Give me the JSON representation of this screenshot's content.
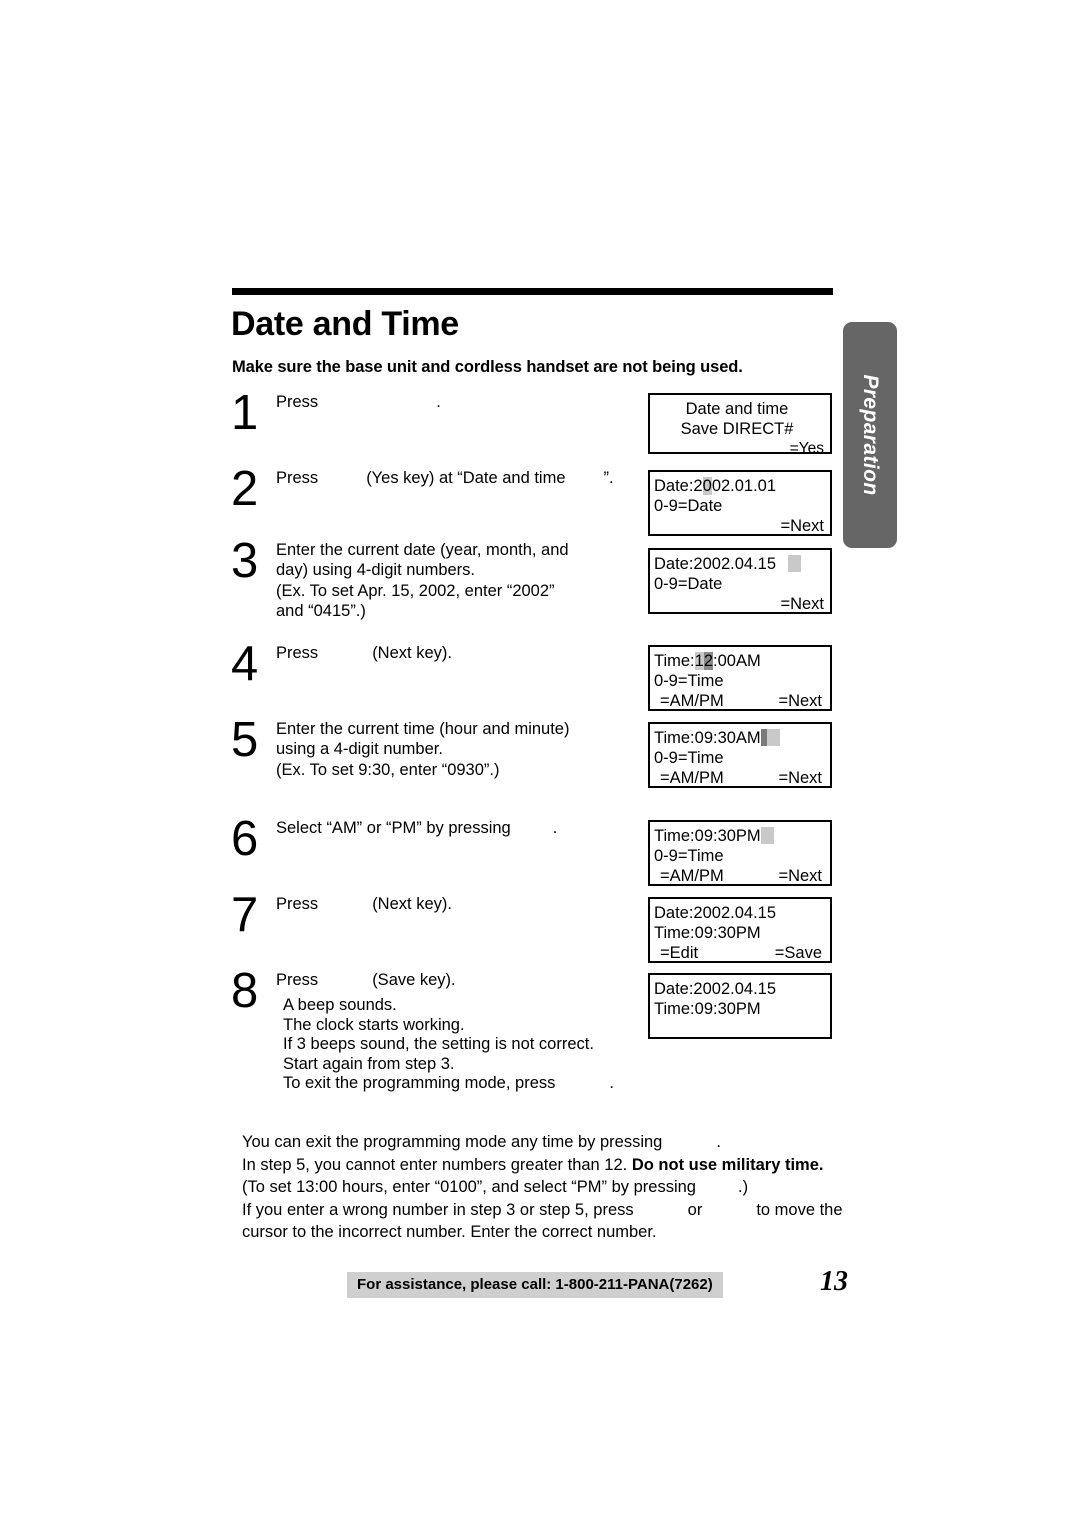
{
  "side_tab": {
    "label": "Preparation",
    "color": "#666666"
  },
  "header": {
    "title": "Date and Time",
    "subtitle": "Make sure the base unit and cordless handset are not being used."
  },
  "steps": [
    {
      "number": "1",
      "text_before": "Press",
      "text_after": "."
    },
    {
      "number": "2",
      "text_before": "Press",
      "text_mid": "(Yes key) at “Date and time",
      "text_after": "”."
    },
    {
      "number": "3",
      "line1": "Enter the current date (year, month, and",
      "line2": "day) using 4-digit numbers.",
      "line3": "(Ex. To set Apr. 15, 2002, enter “2002”",
      "line4": "and “0415”.)"
    },
    {
      "number": "4",
      "text_before": "Press",
      "text_after": "(Next  key)."
    },
    {
      "number": "5",
      "line1": "Enter the current time (hour and minute)",
      "line2": "using a 4-digit number.",
      "line3": "(Ex. To set 9:30, enter “0930”.)"
    },
    {
      "number": "6",
      "text_before": "Select “AM” or “PM” by pressing",
      "text_after": "."
    },
    {
      "number": "7",
      "text_before": "Press",
      "text_after": "(Next  key)."
    },
    {
      "number": "8",
      "text_before": "Press",
      "text_after": "(Save  key).",
      "extra1": "A beep sounds.",
      "extra2": "The clock starts working.",
      "extra3": "If 3 beeps sound, the setting is not correct.",
      "extra4": "Start again from step 3.",
      "extra5_before": "To exit the programming mode, press",
      "extra5_after": "."
    }
  ],
  "lcd_screens": [
    {
      "name": "lcd-1",
      "line1": "Date and time",
      "line2": "Save DIRECT#",
      "line3": "=Yes"
    },
    {
      "name": "lcd-2",
      "line1_pre": "Date:2",
      "line1_cursor": "0",
      "line1_post": "02.01.01",
      "line2": "0-9=Date",
      "line3": "=Next"
    },
    {
      "name": "lcd-3",
      "line1": "Date:2002.04.15",
      "line2": "0-9=Date",
      "line3": "=Next"
    },
    {
      "name": "lcd-4",
      "line1_pre": "Time:",
      "line1_grey": "1",
      "line1_dark": "2",
      "line1_post": ":00AM",
      "line2": "0-9=Time",
      "line3_left": "=AM/PM",
      "line3_right": "=Next"
    },
    {
      "name": "lcd-5",
      "line1": "Time:09:30AM",
      "line2": "0-9=Time",
      "line3_left": "=AM/PM",
      "line3_right": "=Next"
    },
    {
      "name": "lcd-6",
      "line1": "Time:09:30PM",
      "line2": "0-9=Time",
      "line3_left": "=AM/PM",
      "line3_right": "=Next"
    },
    {
      "name": "lcd-7",
      "line1": "Date:2002.04.15",
      "line2": "Time:09:30PM",
      "line3_left": "=Edit",
      "line3_right": "=Save"
    },
    {
      "name": "lcd-8",
      "line1": "Date:2002.04.15",
      "line2": "Time:09:30PM"
    }
  ],
  "notes": {
    "line1_before": "You can exit the programming mode any time by pressing",
    "line1_after": ".",
    "line2_plain": "In step 5, you cannot enter numbers greater than 12.",
    "line2_bold": "Do not use military time.",
    "line3_before": "(To set 13:00 hours, enter “0100”, and select “PM” by pressing",
    "line3_after": ".)",
    "line4_before": "If you enter a wrong number in step 3 or step 5, press",
    "line4_mid": "or",
    "line4_after": "to move the",
    "line5": "cursor to the incorrect number. Enter the correct number."
  },
  "footer": {
    "assistance": "For assistance, please call: 1-800-211-PANA(7262)",
    "page_number": "13"
  }
}
